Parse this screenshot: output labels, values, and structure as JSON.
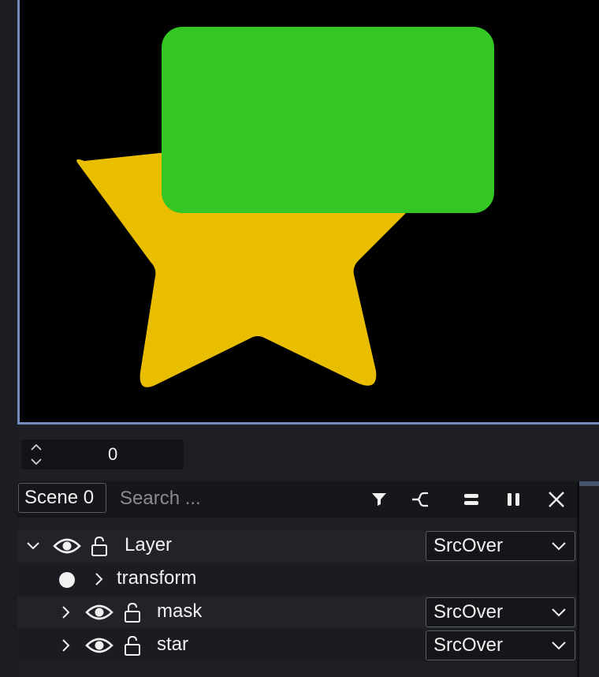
{
  "timeline": {
    "frame_value": "0"
  },
  "outliner": {
    "scene_label": "Scene 0",
    "search_placeholder": "Search ...",
    "toolbar_icons": [
      "filter-icon",
      "link-toggle-icon",
      "equal-icon",
      "pause-icon",
      "close-icon"
    ],
    "rows": [
      {
        "label": "Layer",
        "blend": "SrcOver",
        "expanded": true
      },
      {
        "label": "transform"
      },
      {
        "label": "mask",
        "blend": "SrcOver",
        "expanded": false
      },
      {
        "label": "star",
        "blend": "SrcOver",
        "expanded": false
      }
    ]
  },
  "colors": {
    "star": "#eabe00",
    "rect": "#33c624",
    "canvas_border": "#6f8fbf"
  }
}
